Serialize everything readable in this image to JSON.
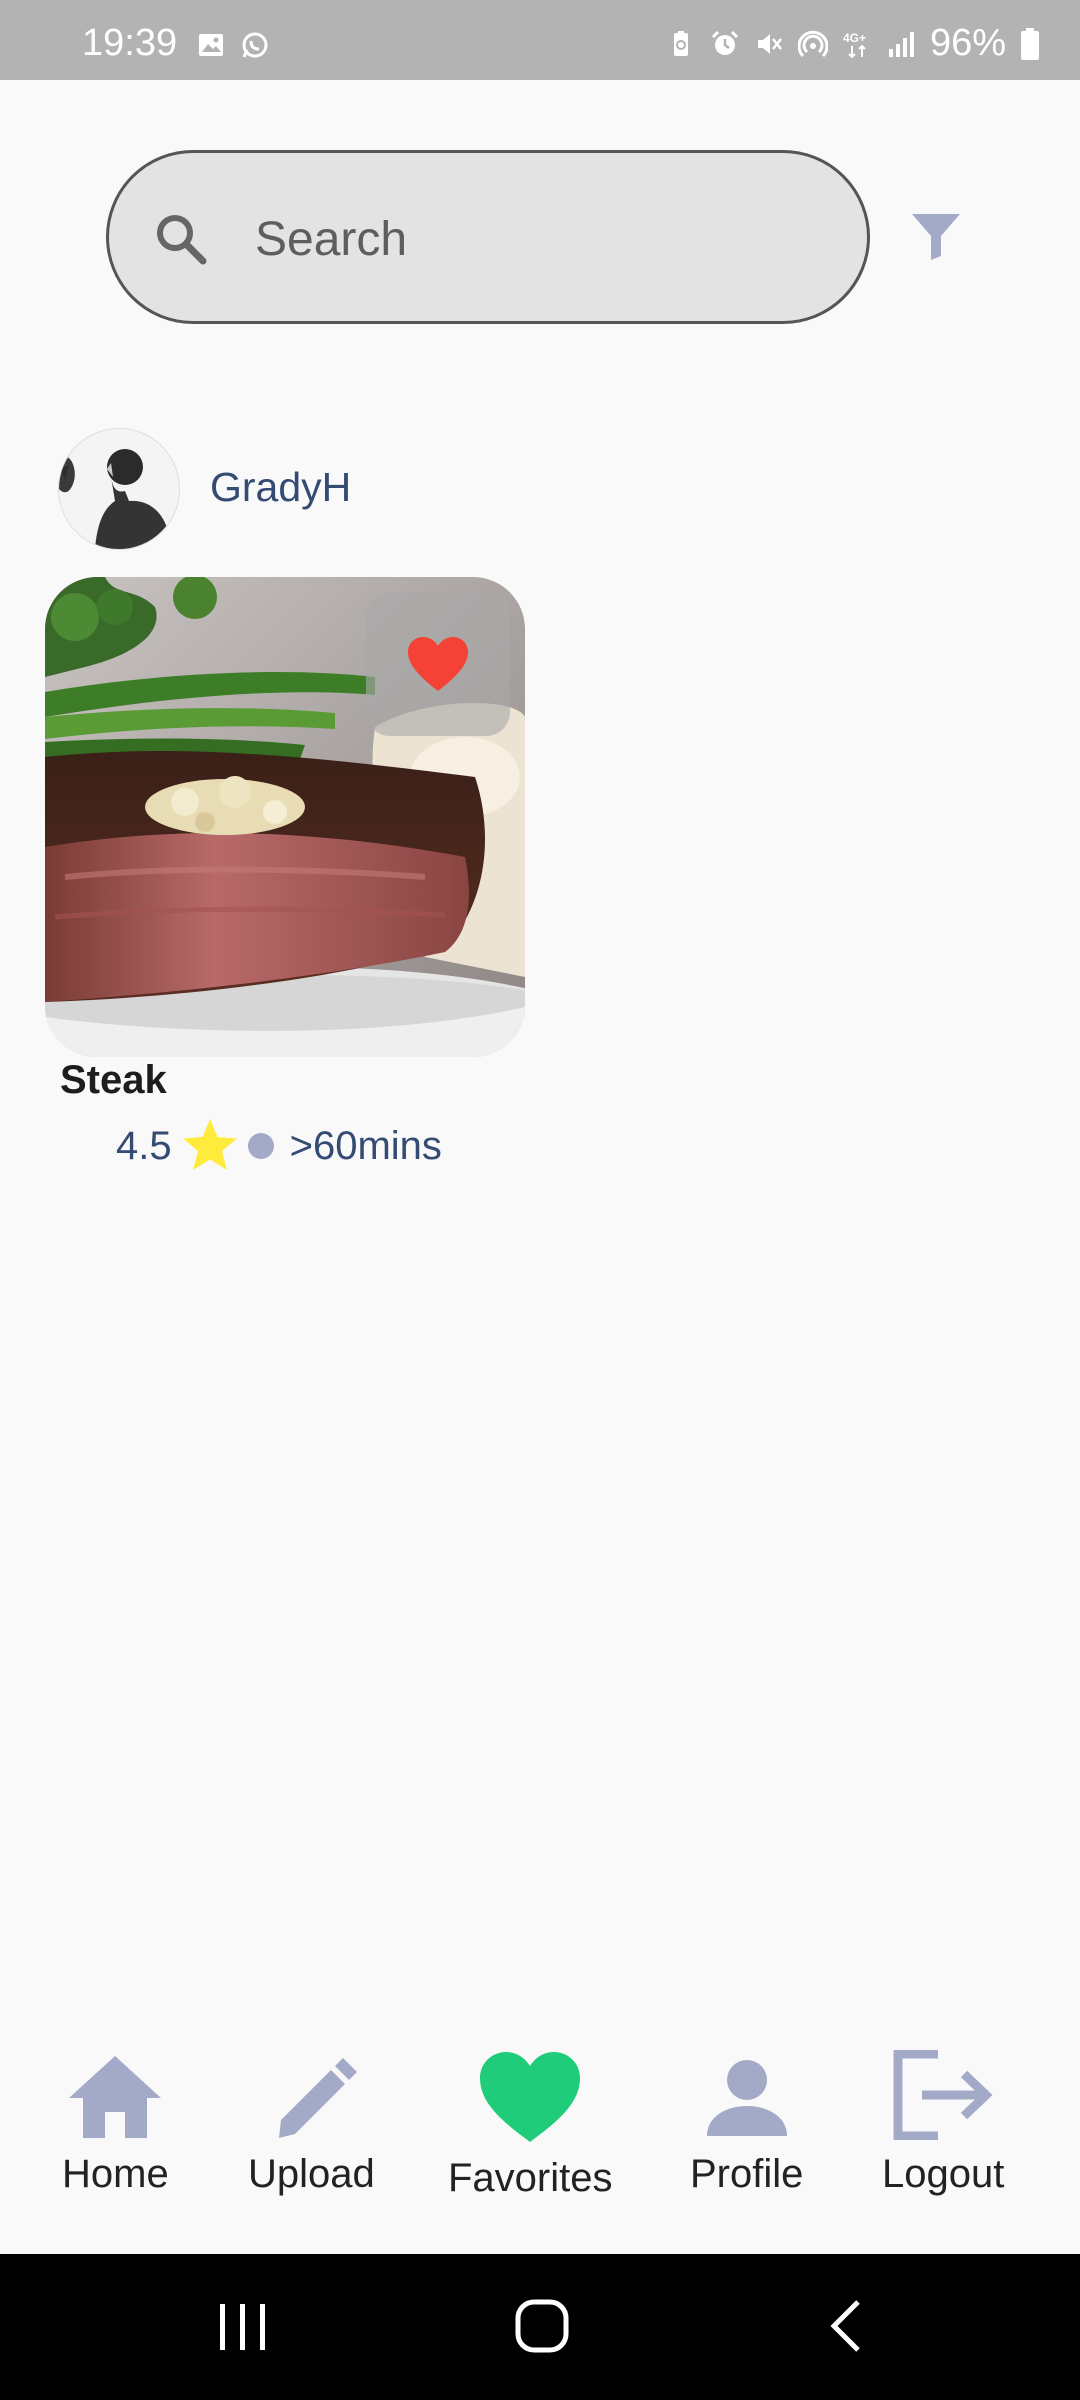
{
  "status_bar": {
    "time": "19:39",
    "battery": "96%",
    "icons": [
      "gallery-icon",
      "whatsapp-icon",
      "battery-saver-icon",
      "alarm-icon",
      "mute-icon",
      "hotspot-icon",
      "4g-icon",
      "signal-icon",
      "battery-icon"
    ]
  },
  "search": {
    "placeholder": "Search",
    "icon": "search-icon"
  },
  "filter": {
    "icon": "filter-icon",
    "color": "#a3aac8"
  },
  "user": {
    "name": "GradyH"
  },
  "recipe": {
    "title": "Steak",
    "rating": "4.5",
    "time": ">60mins",
    "favorited": true,
    "heart_color": "#f44336",
    "star_color": "#ffeb3b"
  },
  "bottom_nav": {
    "items": [
      {
        "label": "Home",
        "icon": "home-icon",
        "active": false
      },
      {
        "label": "Upload",
        "icon": "pencil-icon",
        "active": false
      },
      {
        "label": "Favorites",
        "icon": "heart-icon",
        "active": true
      },
      {
        "label": "Profile",
        "icon": "person-icon",
        "active": false
      },
      {
        "label": "Logout",
        "icon": "logout-icon",
        "active": false
      }
    ],
    "inactive_color": "#a3aac8",
    "active_color": "#1fcc79"
  },
  "system_nav": {
    "buttons": [
      "recent-apps-icon",
      "home-circle-icon",
      "back-icon"
    ]
  }
}
